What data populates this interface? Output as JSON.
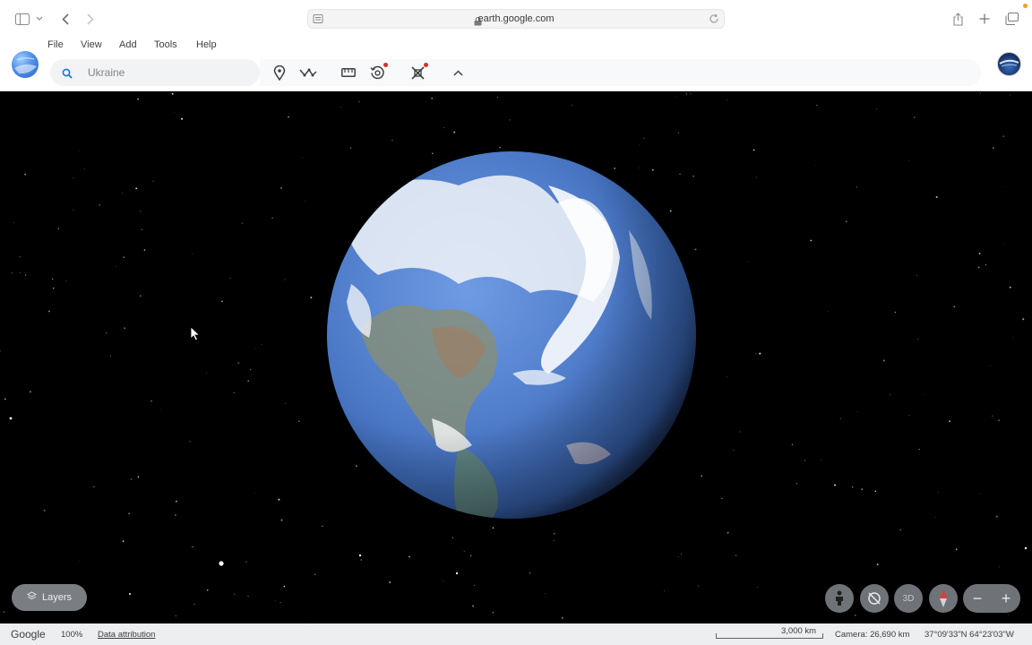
{
  "browser": {
    "url": "earth.google.com",
    "icons": [
      "sidebar-icon",
      "chevron-down-icon",
      "back-icon",
      "forward-icon",
      "reader-icon",
      "lock-icon",
      "reload-icon",
      "share-icon",
      "new-tab-icon",
      "tabs-icon"
    ]
  },
  "menu": {
    "file": "File",
    "view": "View",
    "add": "Add",
    "tools": "Tools",
    "help": "Help"
  },
  "search": {
    "placeholder": "Ukraine"
  },
  "toolbar": {
    "icons": [
      "placemark-icon",
      "path-icon",
      "ruler-icon",
      "historical-imagery-icon",
      "capture-icon",
      "collapse-chevron-icon"
    ],
    "notification_color": "#d93025"
  },
  "map_controls": {
    "layers_label": "Layers",
    "mode_3d": "3D",
    "zoom_in": "+",
    "zoom_out": "−"
  },
  "status": {
    "logo": "Google",
    "zoom": "100%",
    "attribution": "Data attribution",
    "scale": "3,000 km",
    "camera": "Camera: 26,690 km",
    "coords": "37°09'33\"N 64°23'03\"W"
  }
}
